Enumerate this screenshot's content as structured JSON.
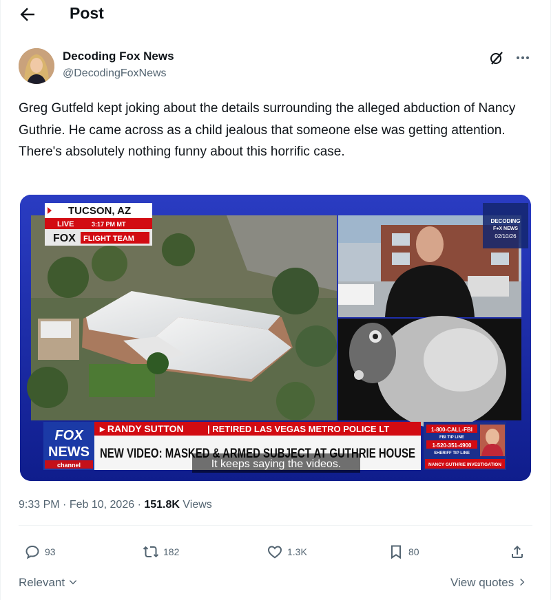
{
  "header": {
    "title": "Post"
  },
  "author": {
    "name": "Decoding Fox News",
    "handle": "@DecodingFoxNews"
  },
  "post": {
    "text": "Greg Gutfeld kept joking about the details surrounding the alleged abduction of Nancy Guthrie. He came across as a child jealous that someone else was getting attention. There's absolutely nothing funny about this horrific case."
  },
  "media": {
    "location": "TUCSON, AZ",
    "live_label": "LIVE",
    "live_time": "3:17 PM MT",
    "flight_team": "FLIGHT TEAM",
    "fox_word": "FOX",
    "watermark_line1": "DECODING",
    "watermark_line2": "F●X NEWS",
    "watermark_date": "02/10/26",
    "lower_third_name": "▸ RANDY SUTTON",
    "lower_third_role": "| RETIRED LAS VEGAS METRO POLICE LT",
    "headline": "NEW VIDEO: MASKED & ARMED SUBJECT AT GUTHRIE HOUSE",
    "caption": "It keeps saying the videos.",
    "logo_fox": "FOX",
    "logo_news": "NEWS",
    "logo_channel": "channel",
    "tip_line_1": "1-800-CALL-FBI",
    "tip_line_1_sub": "FBI TIP LINE",
    "tip_line_2": "1-520-351-4900",
    "tip_line_2_sub": "SHERIFF TIP LINE",
    "tip_footer": "NANCY GUTHRIE INVESTIGATION"
  },
  "meta": {
    "time": "9:33 PM",
    "date": "Feb 10, 2026",
    "views_count": "151.8K",
    "views_label": "Views"
  },
  "actions": {
    "replies": "93",
    "reposts": "182",
    "likes": "1.3K",
    "bookmarks": "80"
  },
  "footer": {
    "relevant": "Relevant",
    "view_quotes": "View quotes"
  }
}
